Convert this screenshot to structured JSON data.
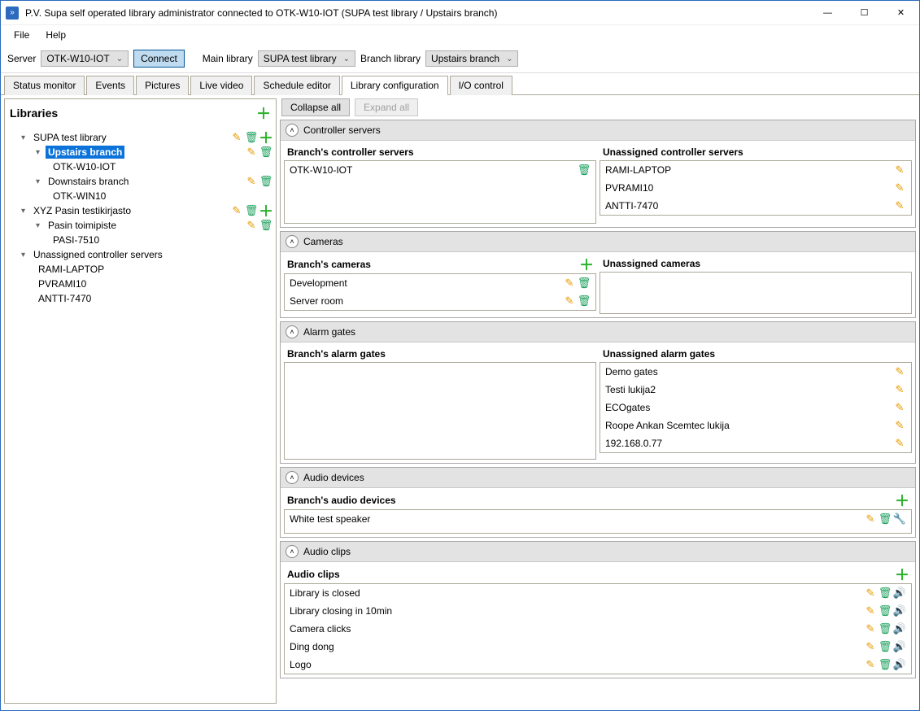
{
  "window": {
    "title": "P.V. Supa self operated library administrator connected to OTK-W10-IOT (SUPA test library / Upstairs branch)"
  },
  "menu": {
    "file": "File",
    "help": "Help"
  },
  "toolbar": {
    "server_label": "Server",
    "server_value": "OTK-W10-IOT",
    "connect": "Connect",
    "main_lib_label": "Main library",
    "main_lib_value": "SUPA test library",
    "branch_lib_label": "Branch library",
    "branch_lib_value": "Upstairs branch"
  },
  "tabs": {
    "status": "Status monitor",
    "events": "Events",
    "pictures": "Pictures",
    "live": "Live video",
    "schedule": "Schedule editor",
    "config": "Library configuration",
    "io": "I/O control"
  },
  "left": {
    "title": "Libraries",
    "tree": {
      "supa": "SUPA test library",
      "up": "Upstairs branch",
      "up1": "OTK-W10-IOT",
      "down": "Downstairs branch",
      "down1": "OTK-WIN10",
      "xyz": "XYZ Pasin testikirjasto",
      "pasin": "Pasin toimipiste",
      "pasi": "PASI-7510",
      "unassigned": "Unassigned controller servers",
      "u1": "RAMI-LAPTOP",
      "u2": "PVRAMI10",
      "u3": "ANTTI-7470"
    }
  },
  "buttons": {
    "collapse": "Collapse all",
    "expand": "Expand all"
  },
  "sections": {
    "controllers": {
      "title": "Controller servers",
      "left_head": "Branch's controller servers",
      "right_head": "Unassigned controller servers",
      "left_items": [
        "OTK-W10-IOT"
      ],
      "right_items": [
        "RAMI-LAPTOP",
        "PVRAMI10",
        "ANTTI-7470"
      ]
    },
    "cameras": {
      "title": "Cameras",
      "left_head": "Branch's cameras",
      "right_head": "Unassigned cameras",
      "left_items": [
        "Development",
        "Server room"
      ],
      "right_items": []
    },
    "gates": {
      "title": "Alarm gates",
      "left_head": "Branch's alarm gates",
      "right_head": "Unassigned alarm gates",
      "left_items": [],
      "right_items": [
        "Demo gates",
        "Testi lukija2",
        "ECOgates",
        "Roope Ankan Scemtec lukija",
        "192.168.0.77"
      ]
    },
    "audio_dev": {
      "title": "Audio devices",
      "head": "Branch's audio devices",
      "items": [
        "White test speaker"
      ]
    },
    "audio_clips": {
      "title": "Audio clips",
      "head": "Audio clips",
      "items": [
        "Library is closed",
        "Library closing in 10min",
        "Camera clicks",
        "Ding dong",
        "Logo"
      ]
    }
  }
}
